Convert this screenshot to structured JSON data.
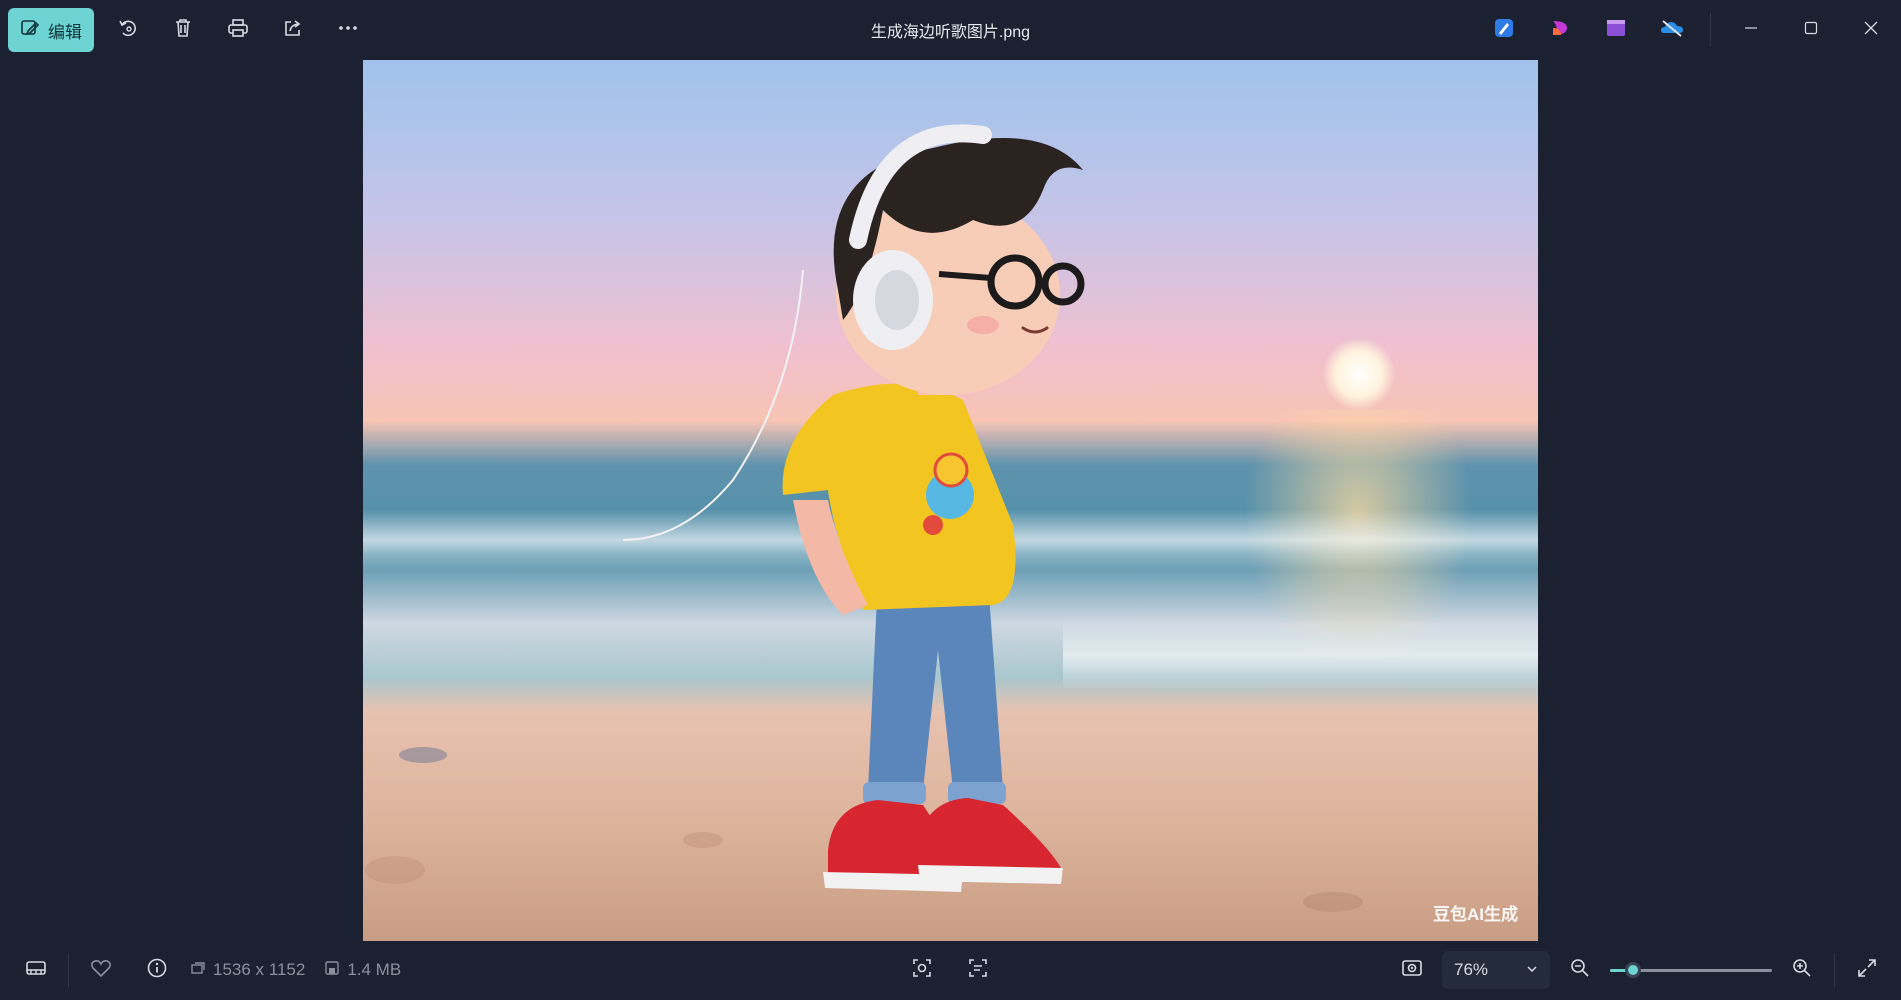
{
  "toolbar": {
    "edit_label": "编辑",
    "icons": [
      "edit-icon",
      "rotate-icon",
      "delete-icon",
      "print-icon",
      "share-icon",
      "more-icon"
    ]
  },
  "window": {
    "title": "生成海边听歌图片.png",
    "app_icons": [
      "designer-icon",
      "clipchamp-icon",
      "video-editor-icon",
      "onedrive-icon"
    ],
    "controls": [
      "minimize-icon",
      "maximize-icon",
      "close-icon"
    ]
  },
  "image": {
    "watermark": "豆包AI生成",
    "colors": {
      "sky_top": "#9fc3ec",
      "sky_pink": "#f1c0cf",
      "sea": "#4f8ea8",
      "sand": "#ddb49c",
      "shirt": "#f3c521",
      "jeans": "#5b86bb",
      "shoes": "#d7262f"
    }
  },
  "statusbar": {
    "dimensions": "1536 x 1152",
    "file_size": "1.4 MB",
    "zoom_level": "76%",
    "zoom_fraction": 0.14
  },
  "colors": {
    "accent": "#6dd3d3",
    "background": "#1b2130"
  }
}
